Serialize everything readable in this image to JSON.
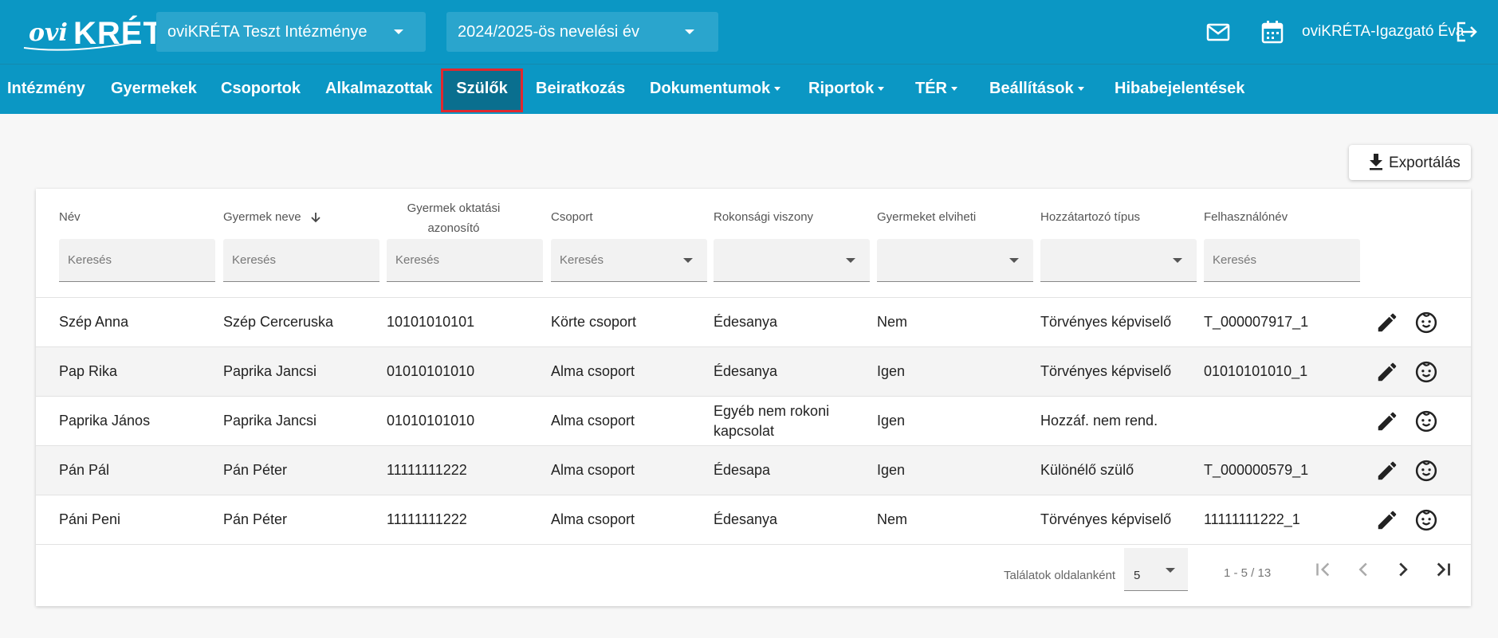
{
  "header": {
    "logo_ovi": "ovi",
    "logo_kreta": "KRÉTA",
    "institution": "oviKRÉTA Teszt Intézménye",
    "year": "2024/2025-ös nevelési év",
    "user": "oviKRÉTA-Igazgató Éva",
    "icons": [
      "mail-icon",
      "calendar-icon",
      "logout-icon"
    ]
  },
  "nav": {
    "items": [
      {
        "label": "Intézmény"
      },
      {
        "label": "Gyermekek"
      },
      {
        "label": "Csoportok"
      },
      {
        "label": "Alkalmazottak"
      },
      {
        "label": "Szülők"
      },
      {
        "label": "Beiratkozás"
      },
      {
        "label": "Dokumentumok"
      },
      {
        "label": "Riportok"
      },
      {
        "label": "TÉR"
      },
      {
        "label": "Beállítások"
      },
      {
        "label": "Hibabejelentések"
      }
    ],
    "active": "Szülők"
  },
  "toolbar": {
    "export_label": "Exportálás"
  },
  "table": {
    "headers": [
      "Név",
      "Gyermek neve",
      "Gyermek oktatási azonosító",
      "Csoport",
      "Rokonsági viszony",
      "Gyermeket elviheti",
      "Hozzátartozó típus",
      "Felhasználónév"
    ],
    "search_placeholder": "Keresés",
    "rows": [
      [
        "Szép Anna",
        "Szép Cerceruska",
        "10101010101",
        "Körte csoport",
        "Édesanya",
        "Nem",
        "Törvényes képviselő",
        "T_000007917_1"
      ],
      [
        "Pap Rika",
        "Paprika Jancsi",
        "01010101010",
        "Alma csoport",
        "Édesanya",
        "Igen",
        "Törvényes képviselő",
        "01010101010_1"
      ],
      [
        "Paprika János",
        "Paprika Jancsi",
        "01010101010",
        "Alma csoport",
        "Egyéb nem rokoni kapcsolat",
        "Igen",
        "Hozzáf. nem rend.",
        ""
      ],
      [
        "Pán Pál",
        "Pán Péter",
        "11111111222",
        "Alma csoport",
        "Édesapa",
        "Igen",
        "Különélő szülő",
        "T_000000579_1"
      ],
      [
        "Páni Peni",
        "Pán Péter",
        "11111111222",
        "Alma csoport",
        "Édesanya",
        "Nem",
        "Törvényes képviselő",
        "11111111222_1"
      ]
    ]
  },
  "pagination": {
    "label": "Találatok oldalanként",
    "page_size": "5",
    "range": "1 - 5 / 13"
  },
  "colors": {
    "primary": "#0b97c4",
    "active_nav": "#0a6f8f",
    "highlight": "#e0282e"
  }
}
